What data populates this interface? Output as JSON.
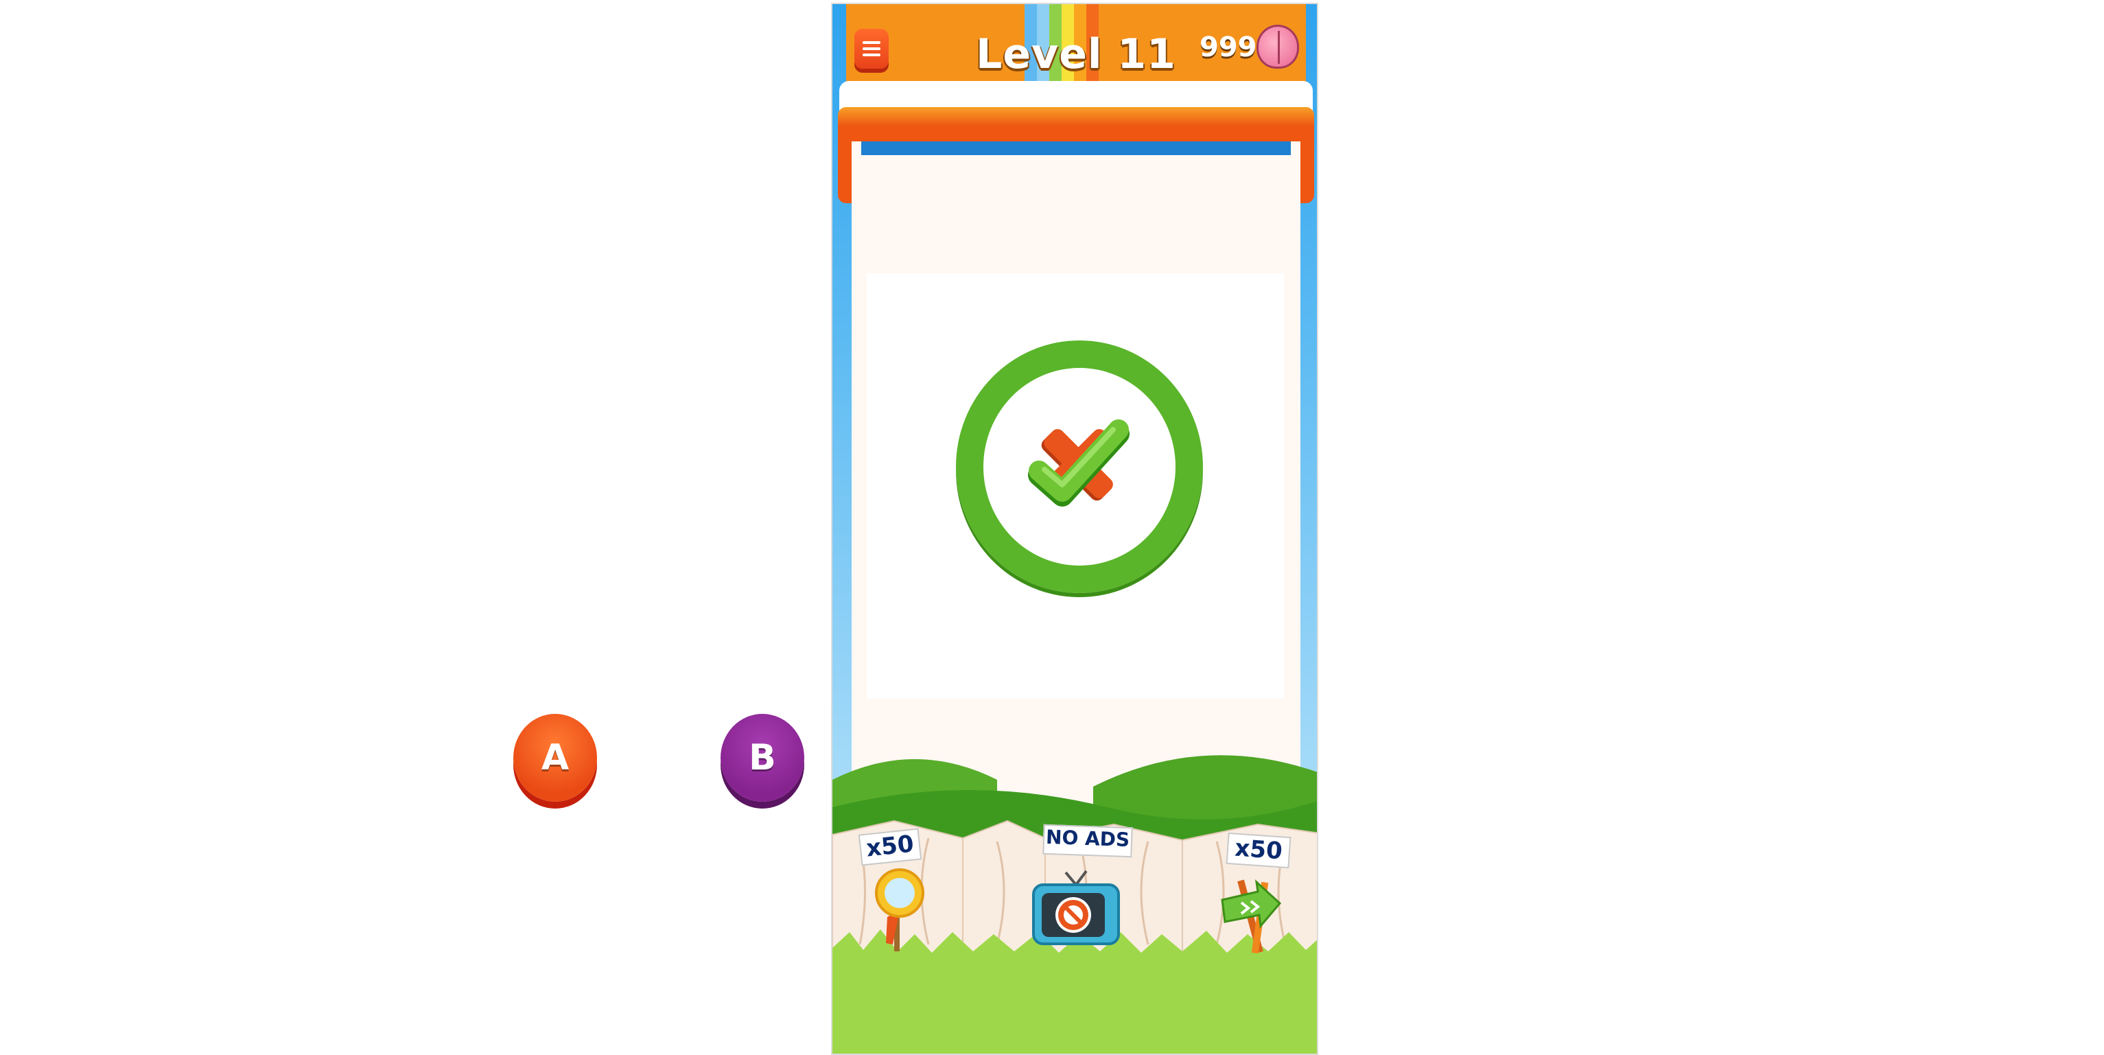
{
  "header": {
    "level_title": "Level 11",
    "coin_count": "999",
    "menu_icon": "hamburger-menu-icon",
    "currency_icon": "brain-icon"
  },
  "puzzle": {
    "image_description_icon": "check-over-cross-in-ring-icon"
  },
  "answers": [
    {
      "label": "A",
      "color": "#ee5a1c"
    },
    {
      "label": "B",
      "color": "#8b2a95"
    }
  ],
  "shop": [
    {
      "label": "x50",
      "icon": "magnifier-hint-icon"
    },
    {
      "label": "NO ADS",
      "icon": "tv-no-ads-icon"
    },
    {
      "label": "x50",
      "icon": "skip-arrow-icon"
    }
  ],
  "colors": {
    "top_bar": "#f5921a",
    "ring_green": "#5ab52a",
    "grass": "#9ed84a"
  }
}
